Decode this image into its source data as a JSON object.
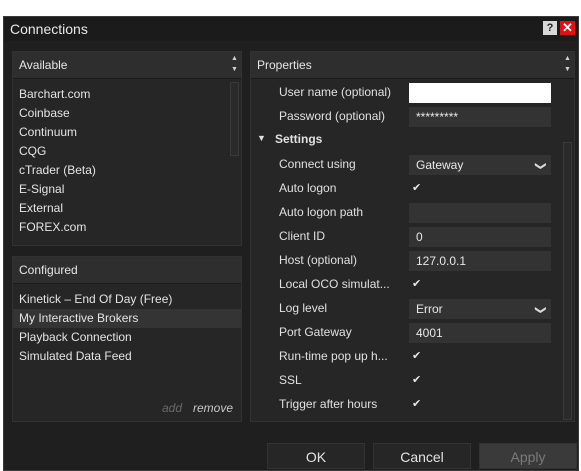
{
  "window": {
    "title": "Connections",
    "help_glyph": "?",
    "close_glyph": "✕"
  },
  "available": {
    "header": "Available",
    "items": [
      "Barchart.com",
      "Coinbase",
      "Continuum",
      "CQG",
      "cTrader (Beta)",
      "E-Signal",
      "External",
      "FOREX.com"
    ]
  },
  "configured": {
    "header": "Configured",
    "items": [
      "Kinetick – End Of Day (Free)",
      "My Interactive Brokers",
      "Playback Connection",
      "Simulated Data Feed"
    ],
    "selected_index": 1,
    "add_label": "add",
    "remove_label": "remove"
  },
  "properties": {
    "header": "Properties",
    "user_name": {
      "label": "User name (optional)",
      "value": ""
    },
    "password": {
      "label": "Password (optional)",
      "value": "*********"
    },
    "settings_label": "Settings",
    "connect_using": {
      "label": "Connect using",
      "value": "Gateway"
    },
    "auto_logon": {
      "label": "Auto logon",
      "checked": true
    },
    "auto_logon_path": {
      "label": "Auto logon path",
      "value": ""
    },
    "client_id": {
      "label": "Client ID",
      "value": "0"
    },
    "host": {
      "label": "Host (optional)",
      "value": "127.0.0.1"
    },
    "local_oco": {
      "label": "Local OCO simulat...",
      "checked": true
    },
    "log_level": {
      "label": "Log level",
      "value": "Error"
    },
    "port_gateway": {
      "label": "Port Gateway",
      "value": "4001"
    },
    "runtime_popup": {
      "label": "Run-time pop up h...",
      "checked": true
    },
    "ssl": {
      "label": "SSL",
      "checked": true
    },
    "trigger_after_hours": {
      "label": "Trigger after hours",
      "checked": true
    }
  },
  "buttons": {
    "ok": "OK",
    "cancel": "Cancel",
    "apply": "Apply"
  },
  "glyphs": {
    "check": "✔",
    "chevron": "❯",
    "collapse": "▼",
    "scroll_up": "▲",
    "scroll_down": "▼"
  },
  "colors": {
    "background": "#1f1f1f",
    "close": "#e01010"
  }
}
